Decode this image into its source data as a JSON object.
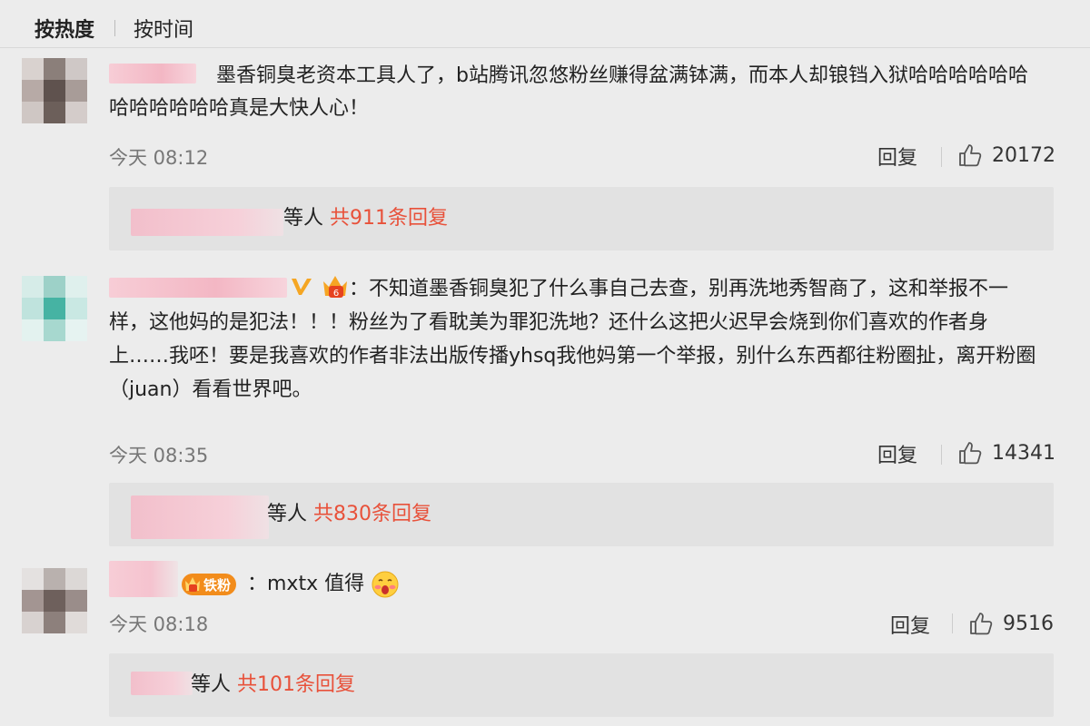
{
  "sort_tabs": {
    "hot": "按热度",
    "time": "按时间"
  },
  "comments": [
    {
      "text": "墨香铜臭老资本工具人了，b站腾讯忽悠粉丝赚得盆满钵满，而本人却锒铛入狱哈哈哈哈哈哈哈哈哈哈哈哈真是大快人心！",
      "time": "今天 08:12",
      "reply_label": "回复",
      "likes": "20172",
      "replies_prefix": "等人",
      "replies_count": "共911条回复"
    },
    {
      "prefix": "：",
      "text": "不知道墨香铜臭犯了什么事自己去查，别再洗地秀智商了，这和举报不一样，这他妈的是犯法！！！粉丝为了看耽美为罪犯洗地？还什么这把火迟早会烧到你们喜欢的作者身上……我呸！要是我喜欢的作者非法出版传播yhsq我他妈第一个举报，别什么东西都往粉圈扯，离开粉圈（juan）看看世界吧。",
      "vip_mark": "V",
      "time": "今天 08:35",
      "reply_label": "回复",
      "likes": "14341",
      "replies_prefix": "等人",
      "replies_count": "共830条回复"
    },
    {
      "badge_text": "铁粉",
      "text": "：mxtx 值得",
      "time": "今天 08:18",
      "reply_label": "回复",
      "likes": "9516",
      "replies_prefix": "等人",
      "replies_count": "共101条回复"
    }
  ],
  "colors": {
    "reply_count": "#e8513a",
    "username_blur": "#f3b7c4",
    "badge_orange": "#f28c1b"
  },
  "icons": [
    "thumbs-up-icon",
    "vip-badge-icon",
    "crown-icon",
    "fan-badge-icon",
    "blush-emoji-icon"
  ]
}
